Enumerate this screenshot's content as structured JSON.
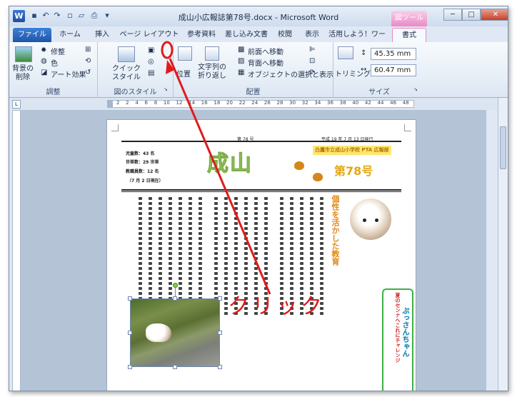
{
  "window": {
    "title": "成山小広報誌第78号.docx - Microsoft Word",
    "context_tab_group": "図ツール",
    "app_icon": "W"
  },
  "quick_access": [
    "save-icon",
    "undo-icon",
    "redo-icon",
    "new-doc-icon",
    "open-icon",
    "print-preview-icon",
    "customize-icon"
  ],
  "window_controls": {
    "minimize": "─",
    "restore": "□",
    "close": "✕"
  },
  "tabs": [
    "ファイル",
    "ホーム",
    "挿入",
    "ページ レイアウト",
    "参考資料",
    "差し込み文書",
    "校閲",
    "表示",
    "活用しよう！ワード",
    "書式"
  ],
  "ribbon": {
    "groups": {
      "adjust": "調整",
      "picture_styles": "図のスタイル",
      "arrange": "配置",
      "size": "サイズ"
    },
    "buttons": {
      "remove_bg": "背景の\n削除",
      "corrections": "修整",
      "color": "色",
      "artistic": "アート効果",
      "quick_styles": "クイック\nスタイル",
      "position": "位置",
      "wrap_text": "文字列の\n折り返し",
      "bring_forward": "前面へ移動",
      "send_backward": "背面へ移動",
      "selection_pane": "オブジェクトの選択と表示",
      "crop": "トリミング"
    },
    "height": "45.35 mm",
    "width": "60.47 mm"
  },
  "ruler": {
    "ticks": [
      "2",
      "2",
      "4",
      "6",
      "8",
      "10",
      "12",
      "14",
      "16",
      "18",
      "20",
      "22",
      "24",
      "26",
      "28",
      "30",
      "32",
      "34",
      "36",
      "38",
      "40",
      "42",
      "44",
      "46",
      "48"
    ]
  },
  "document": {
    "issue_line": "第 78 号",
    "date_line": "平成 19 年 7 月 13 日発行",
    "stats": [
      "児童数：43 名",
      "世帯数：29 世帯",
      "教職員数：12 名",
      "（7 月 2 日現在）"
    ],
    "masthead": "成山",
    "school_name": "白鷹市立成山小学校 PTA 広報部",
    "issue_badge": "第78号",
    "orange_heading": "個性を活かした教育",
    "green_box_title": "夏のセンナへこれにチャレンジ",
    "green_box_body": "ぶっさんちゃん"
  },
  "annotation": {
    "label": "クリック",
    "color": "#e01b1b"
  }
}
